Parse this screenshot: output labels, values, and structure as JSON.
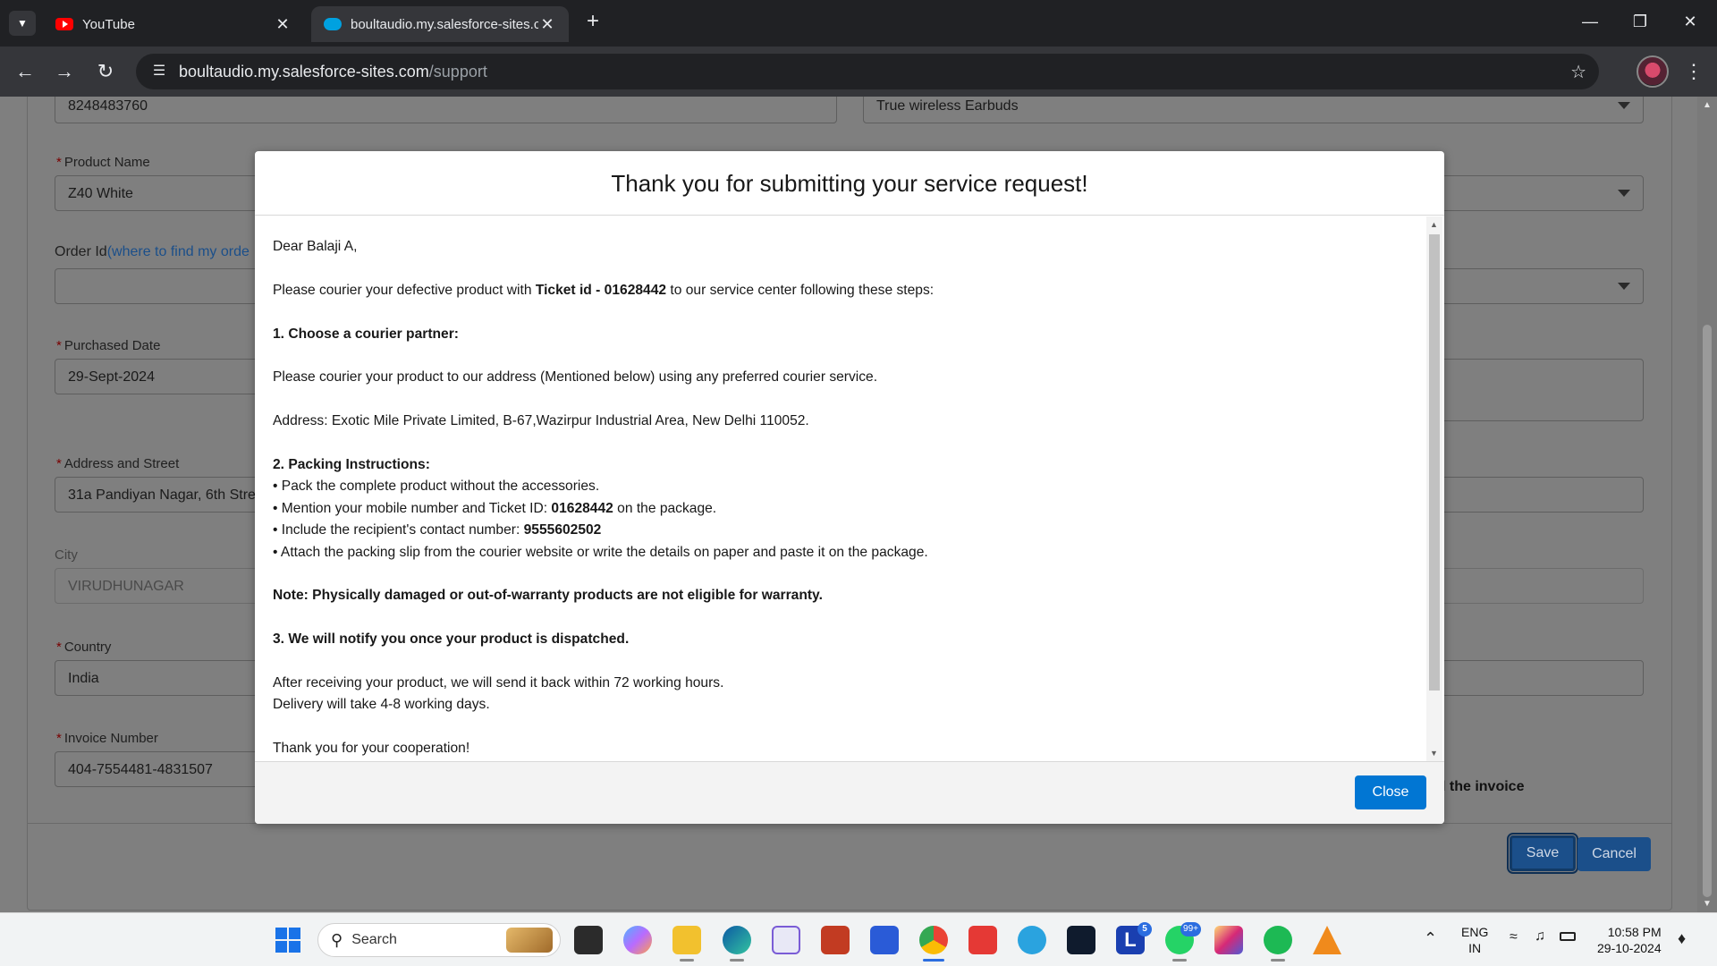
{
  "browser": {
    "tabs": [
      {
        "title": "YouTube",
        "icon": "youtube-icon",
        "active": false
      },
      {
        "title": "boultaudio.my.salesforce-sites.c",
        "icon": "salesforce-icon",
        "active": true
      }
    ],
    "url_host": "boultaudio.my.salesforce-sites.com",
    "url_path": "/support"
  },
  "form": {
    "mobile_value": "8248483760",
    "category_value": "True wireless Earbuds",
    "product_name_label": "Product Name",
    "product_name_value": "Z40 White",
    "order_id_label": "Order Id",
    "order_id_link": "(where to find my orde",
    "purchased_date_label": "Purchased Date",
    "purchased_date_value": "29-Sept-2024",
    "address_label": "Address and Street",
    "address_value": "31a Pandiyan Nagar, 6th Stre",
    "city_label": "City",
    "city_value": "VIRUDHUNAGAR",
    "country_label": "Country",
    "country_value": "India",
    "invoice_label": "Invoice Number",
    "invoice_value": "404-7554481-4831507",
    "invoice_partial_label": "l the invoice",
    "required_marker": "*",
    "save_label": "Save",
    "cancel_label": "Cancel"
  },
  "modal": {
    "title": "Thank you for submitting your service request!",
    "greeting": "Dear Balaji A,",
    "intro_pre": "Please courier your defective product with ",
    "intro_ticket": "Ticket id - 01628442",
    "intro_post": " to our service center following these steps:",
    "step1_heading": "1. Choose a courier partner:",
    "step1_text": "Please courier your product to our address (Mentioned below) using any preferred courier service.",
    "address_text": "Address: Exotic Mile Private Limited, B-67,Wazirpur Industrial Area, New Delhi 110052.",
    "step2_heading": "2. Packing Instructions:",
    "pack1": "• Pack the complete product without the accessories.",
    "pack2_pre": "• Mention your mobile number and Ticket ID: ",
    "pack2_ticket": "01628442",
    "pack2_post": " on the package.",
    "pack3_pre": "• Include the recipient's contact number: ",
    "pack3_number": "9555602502",
    "pack4": "• Attach the packing slip from the courier website or write the details on paper and paste it on the package.",
    "note": "Note: Physically damaged or out-of-warranty products are not eligible for warranty.",
    "step3_heading": "3. We will notify you once your product is dispatched.",
    "after1": "After receiving your product, we will send it back within 72 working hours.",
    "after2": "Delivery will take 4-8 working days.",
    "thanks": "Thank you for your cooperation!",
    "close_label": "Close"
  },
  "taskbar": {
    "search_placeholder": "Search",
    "l_badge": "5",
    "whatsapp_badge": "99+",
    "lang_top": "ENG",
    "lang_bottom": "IN",
    "time": "10:58 PM",
    "date": "29-10-2024"
  },
  "colors": {
    "accent": "#0176d3",
    "overlay_page": "#7f7f7f",
    "chrome_dark": "#202124"
  }
}
